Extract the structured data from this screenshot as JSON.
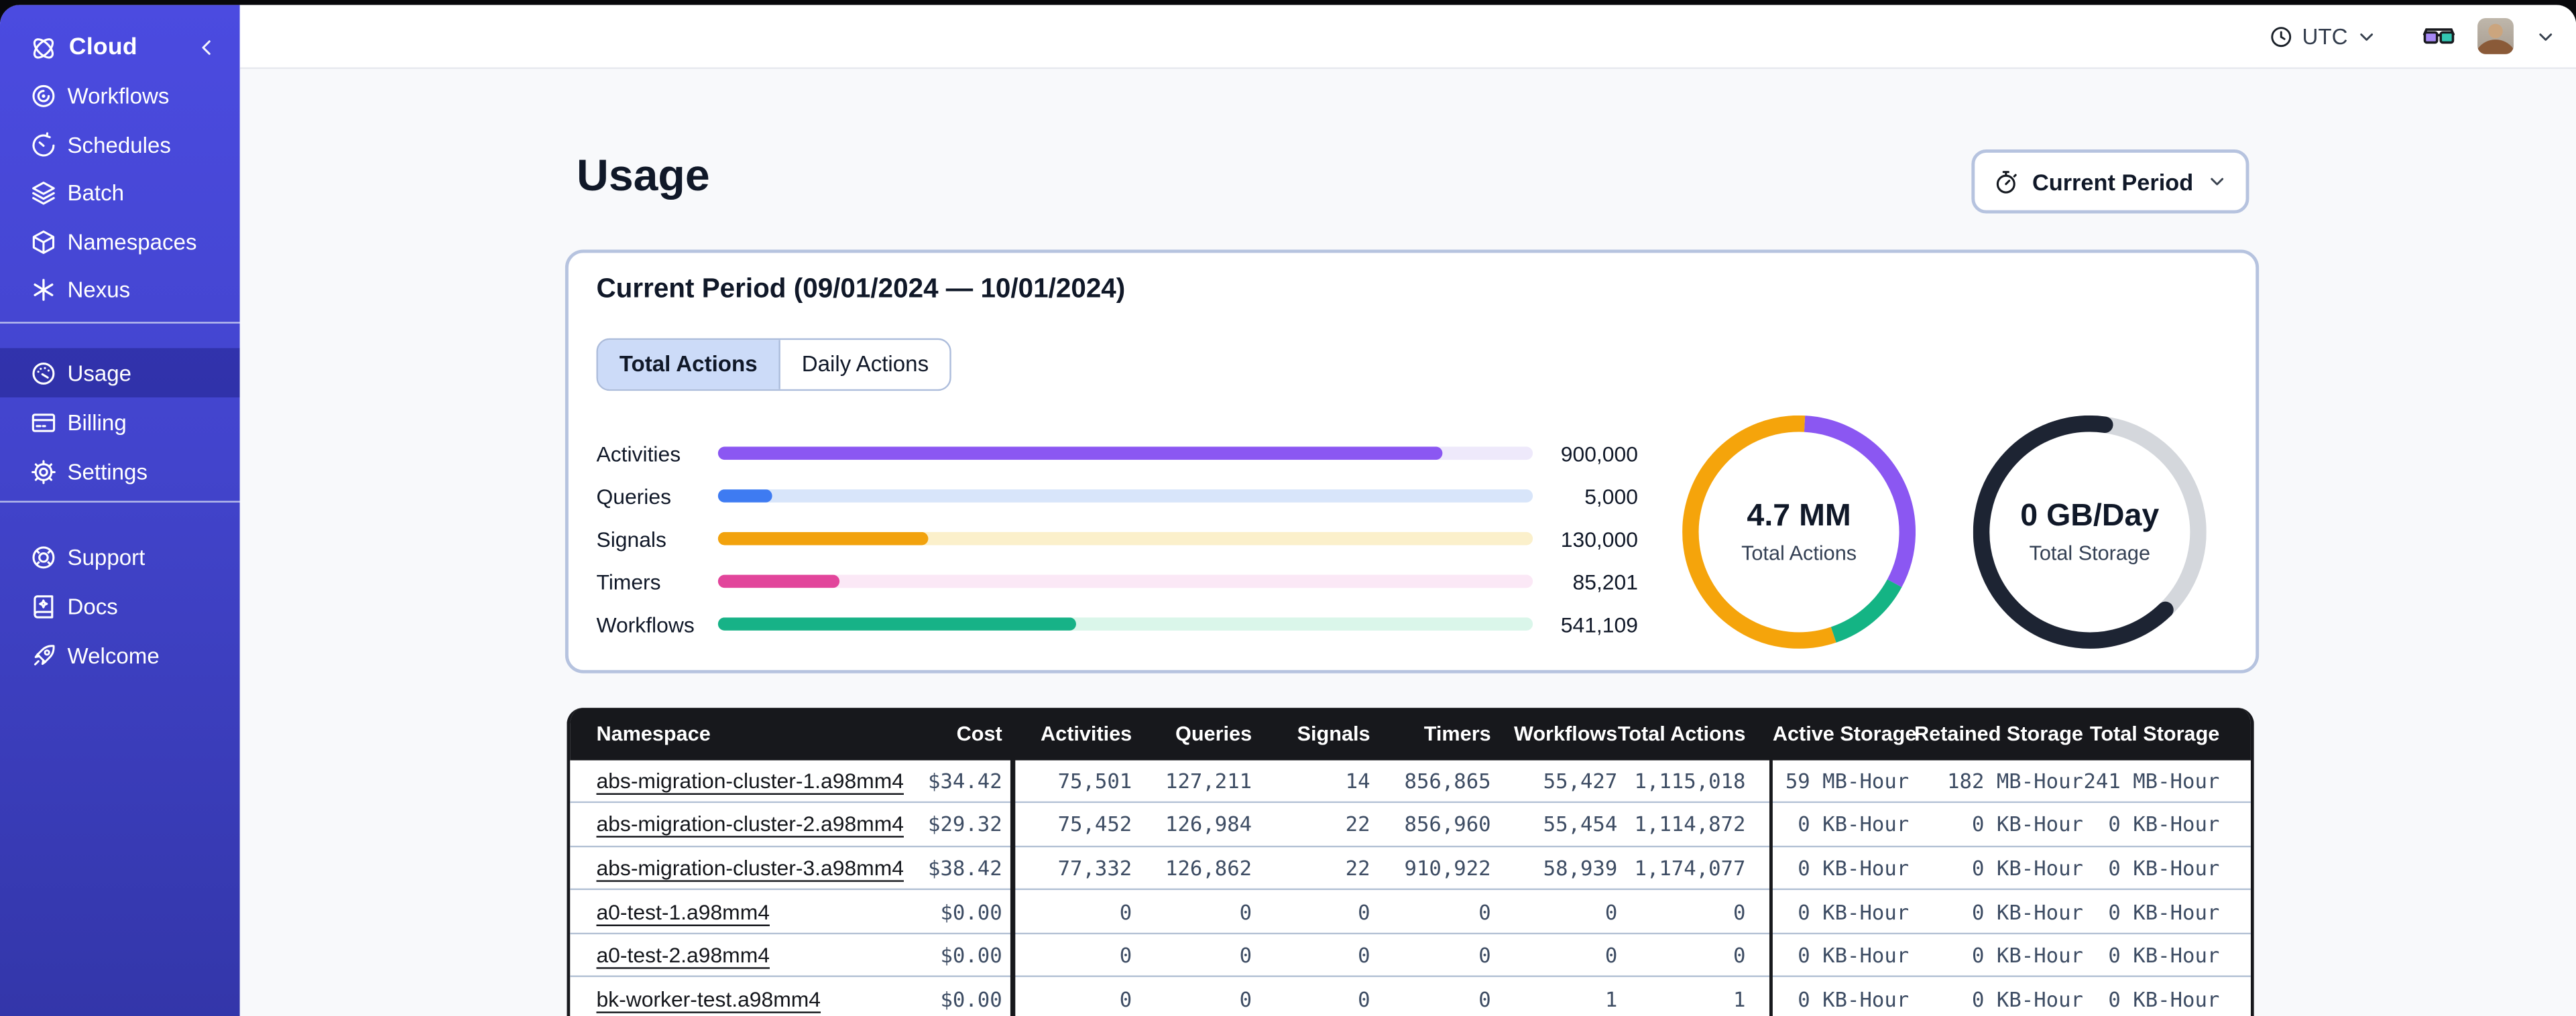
{
  "sidebar": {
    "brand": {
      "label": "Cloud",
      "icon": "temporal-logo-icon"
    },
    "nav_main": [
      {
        "label": "Workflows",
        "icon": "workflows-icon"
      },
      {
        "label": "Schedules",
        "icon": "schedules-icon"
      },
      {
        "label": "Batch",
        "icon": "batch-icon"
      },
      {
        "label": "Namespaces",
        "icon": "namespaces-icon"
      },
      {
        "label": "Nexus",
        "icon": "nexus-icon"
      }
    ],
    "nav_account": [
      {
        "label": "Usage",
        "icon": "usage-icon",
        "active": true
      },
      {
        "label": "Billing",
        "icon": "billing-icon"
      },
      {
        "label": "Settings",
        "icon": "settings-icon"
      }
    ],
    "nav_footer": [
      {
        "label": "Support",
        "icon": "support-icon"
      },
      {
        "label": "Docs",
        "icon": "docs-icon"
      },
      {
        "label": "Welcome",
        "icon": "welcome-icon"
      }
    ]
  },
  "topbar": {
    "timezone": "UTC"
  },
  "page": {
    "title": "Usage",
    "period_button_label": "Current Period"
  },
  "usage_card": {
    "title": "Current Period (09/01/2024 — 10/01/2024)",
    "tabs": [
      {
        "label": "Total Actions",
        "active": true
      },
      {
        "label": "Daily Actions",
        "active": false
      }
    ]
  },
  "chart_data": [
    {
      "id": "actions-breakdown-bars",
      "type": "bar",
      "orientation": "horizontal",
      "categories": [
        "Activities",
        "Queries",
        "Signals",
        "Timers",
        "Workflows"
      ],
      "values": [
        900000,
        5000,
        130000,
        85201,
        541109
      ],
      "value_labels": [
        "900,000",
        "5,000",
        "130,000",
        "85,201",
        "541,109"
      ],
      "fill_fractions": [
        0.89,
        0.067,
        0.26,
        0.151,
        0.44
      ],
      "bar_colors": [
        "#8B57F2",
        "#3E7BF2",
        "#F2A20D",
        "#E2459B",
        "#17B287"
      ],
      "track_colors": [
        "#EEE9FB",
        "#D8E5FA",
        "#FBF0CB",
        "#FBE8F6",
        "#DAF6EA"
      ]
    },
    {
      "id": "total-actions-donut",
      "type": "donut",
      "center_value": "4.7 MM",
      "center_label": "Total Actions",
      "start_angle_deg": 3,
      "segments": [
        {
          "name": "activities",
          "color": "#8B57F2",
          "fraction": 0.32
        },
        {
          "name": "workflows",
          "color": "#14B484",
          "fraction": 0.12
        },
        {
          "name": "signals",
          "color": "#F5A40B",
          "fraction": 0.56
        }
      ]
    },
    {
      "id": "total-storage-donut",
      "type": "donut",
      "center_value": "0 GB/Day",
      "center_label": "Total Storage",
      "start_angle_deg": 8,
      "segments": [
        {
          "name": "free",
          "color": "#D4D7DC",
          "fraction": 0.355
        },
        {
          "name": "used",
          "color": "#1D2433",
          "fraction": 0.645,
          "cap": "round"
        }
      ]
    }
  ],
  "table": {
    "columns": [
      {
        "label": "Namespace",
        "align": "left"
      },
      {
        "label": "Cost",
        "align": "right"
      },
      {
        "label": "Activities",
        "align": "right"
      },
      {
        "label": "Queries",
        "align": "right"
      },
      {
        "label": "Signals",
        "align": "right"
      },
      {
        "label": "Timers",
        "align": "right"
      },
      {
        "label": "Workflows",
        "align": "right"
      },
      {
        "label": "Total Actions",
        "align": "right"
      },
      {
        "label": "Active Storage",
        "align": "right"
      },
      {
        "label": "Retained Storage",
        "align": "right"
      },
      {
        "label": "Total Storage",
        "align": "right"
      }
    ],
    "rows": [
      {
        "namespace": "abs-migration-cluster-1.a98mm4",
        "cells": [
          "$34.42",
          "75,501",
          "127,211",
          "14",
          "856,865",
          "55,427",
          "1,115,018",
          "59 MB-Hour",
          "182 MB-Hour",
          "241 MB-Hour"
        ]
      },
      {
        "namespace": "abs-migration-cluster-2.a98mm4",
        "cells": [
          "$29.32",
          "75,452",
          "126,984",
          "22",
          "856,960",
          "55,454",
          "1,114,872",
          "0 KB-Hour",
          "0 KB-Hour",
          "0 KB-Hour"
        ]
      },
      {
        "namespace": "abs-migration-cluster-3.a98mm4",
        "cells": [
          "$38.42",
          "77,332",
          "126,862",
          "22",
          "910,922",
          "58,939",
          "1,174,077",
          "0 KB-Hour",
          "0 KB-Hour",
          "0 KB-Hour"
        ]
      },
      {
        "namespace": "a0-test-1.a98mm4",
        "cells": [
          "$0.00",
          "0",
          "0",
          "0",
          "0",
          "0",
          "0",
          "0 KB-Hour",
          "0 KB-Hour",
          "0 KB-Hour"
        ]
      },
      {
        "namespace": "a0-test-2.a98mm4",
        "cells": [
          "$0.00",
          "0",
          "0",
          "0",
          "0",
          "0",
          "0",
          "0 KB-Hour",
          "0 KB-Hour",
          "0 KB-Hour"
        ]
      },
      {
        "namespace": "bk-worker-test.a98mm4",
        "cells": [
          "$0.00",
          "0",
          "0",
          "0",
          "0",
          "1",
          "1",
          "0 KB-Hour",
          "0 KB-Hour",
          "0 KB-Hour"
        ]
      }
    ]
  }
}
